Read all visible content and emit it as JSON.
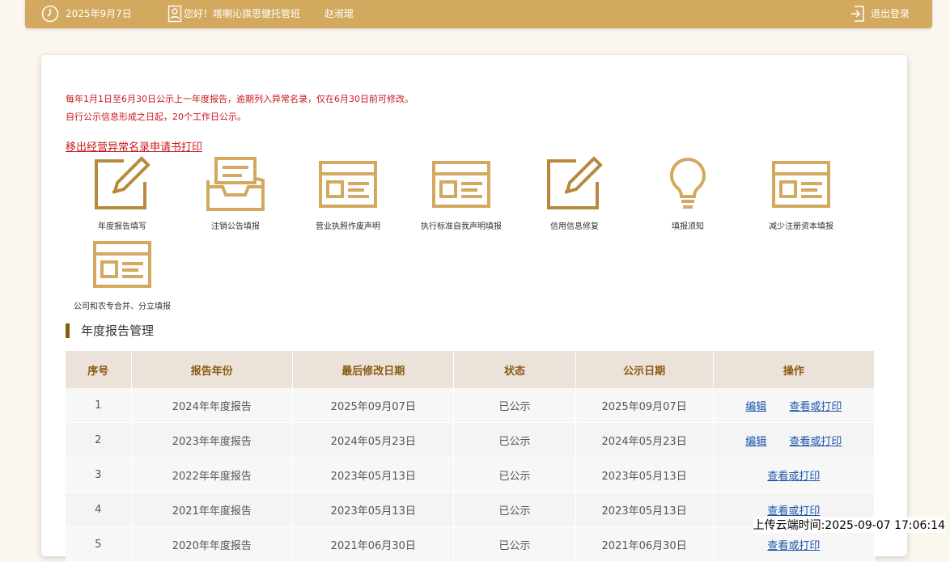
{
  "topbar": {
    "date": "2025年9月7日",
    "greeting": "您好！喀喇沁旗思健托管班",
    "user": "赵淑琨",
    "logout": "退出登录",
    "color": "#d2a95e"
  },
  "notices": {
    "line1": "每年1月1日至6月30日公示上一年度报告，逾期列入异常名录，仅在6月30日前可修改。",
    "line2": "自行公示信息形成之日起，20个工作日公示。"
  },
  "print_link": "移出经营异常名录申请书打印",
  "tiles": [
    {
      "label": "年度报告填写",
      "icon": "edit-icon"
    },
    {
      "label": "注销公告填报",
      "icon": "inbox-icon"
    },
    {
      "label": "营业执照作废声明",
      "icon": "form-icon"
    },
    {
      "label": "执行标准自我声明填报",
      "icon": "form-icon"
    },
    {
      "label": "信用信息修复",
      "icon": "edit-icon"
    },
    {
      "label": "填报须知",
      "icon": "lightbulb-icon"
    },
    {
      "label": "减少注册资本填报",
      "icon": "form-icon"
    },
    {
      "label": "公司和农专合并、分立填报",
      "icon": "form-icon"
    }
  ],
  "section_title": "年度报告管理",
  "table": {
    "headers": [
      "序号",
      "报告年份",
      "最后修改日期",
      "状态",
      "公示日期",
      "操作"
    ],
    "rows": [
      {
        "no": "1",
        "year": "2024年年度报告",
        "modified": "2025年09月07日",
        "status": "已公示",
        "published": "2025年09月07日",
        "edit": "编辑",
        "view": "查看或打印"
      },
      {
        "no": "2",
        "year": "2023年年度报告",
        "modified": "2024年05月23日",
        "status": "已公示",
        "published": "2024年05月23日",
        "edit": "编辑",
        "view": "查看或打印"
      },
      {
        "no": "3",
        "year": "2022年年度报告",
        "modified": "2023年05月13日",
        "status": "已公示",
        "published": "2023年05月13日",
        "view": "查看或打印"
      },
      {
        "no": "4",
        "year": "2021年年度报告",
        "modified": "2023年05月13日",
        "status": "已公示",
        "published": "2023年05月13日",
        "view": "查看或打印"
      },
      {
        "no": "5",
        "year": "2020年年度报告",
        "modified": "2021年06月30日",
        "status": "已公示",
        "published": "2021年06月30日",
        "view": "查看或打印"
      }
    ]
  },
  "upload_time": "上传云端时间:2025-09-07 17:06:14"
}
